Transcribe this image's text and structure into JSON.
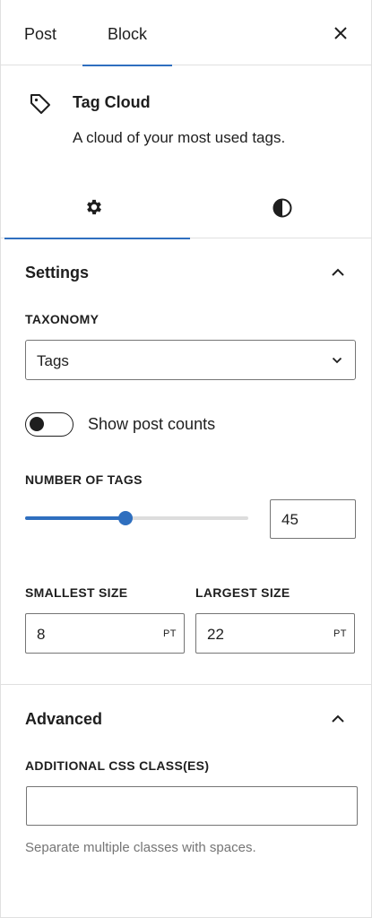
{
  "tabs": {
    "post": "Post",
    "block": "Block"
  },
  "block": {
    "title": "Tag Cloud",
    "description": "A cloud of your most used tags."
  },
  "settings": {
    "title": "Settings",
    "taxonomy": {
      "label": "TAXONOMY",
      "value": "Tags"
    },
    "show_post_counts": {
      "label": "Show post counts",
      "checked": false
    },
    "number_of_tags": {
      "label": "NUMBER OF TAGS",
      "value": "45",
      "fraction": 0.45
    },
    "smallest_size": {
      "label": "SMALLEST SIZE",
      "value": "8",
      "unit": "PT"
    },
    "largest_size": {
      "label": "LARGEST SIZE",
      "value": "22",
      "unit": "PT"
    }
  },
  "advanced": {
    "title": "Advanced",
    "css_label": "ADDITIONAL CSS CLASS(ES)",
    "css_value": "",
    "help": "Separate multiple classes with spaces."
  },
  "colors": {
    "accent": "#2f6fbf",
    "text": "#1e1e1e",
    "muted": "#757575",
    "border": "#e0e0e0"
  },
  "icons": [
    "close-icon",
    "tag-icon",
    "gear-icon",
    "contrast-icon",
    "chevron-up-icon",
    "chevron-down-icon"
  ]
}
